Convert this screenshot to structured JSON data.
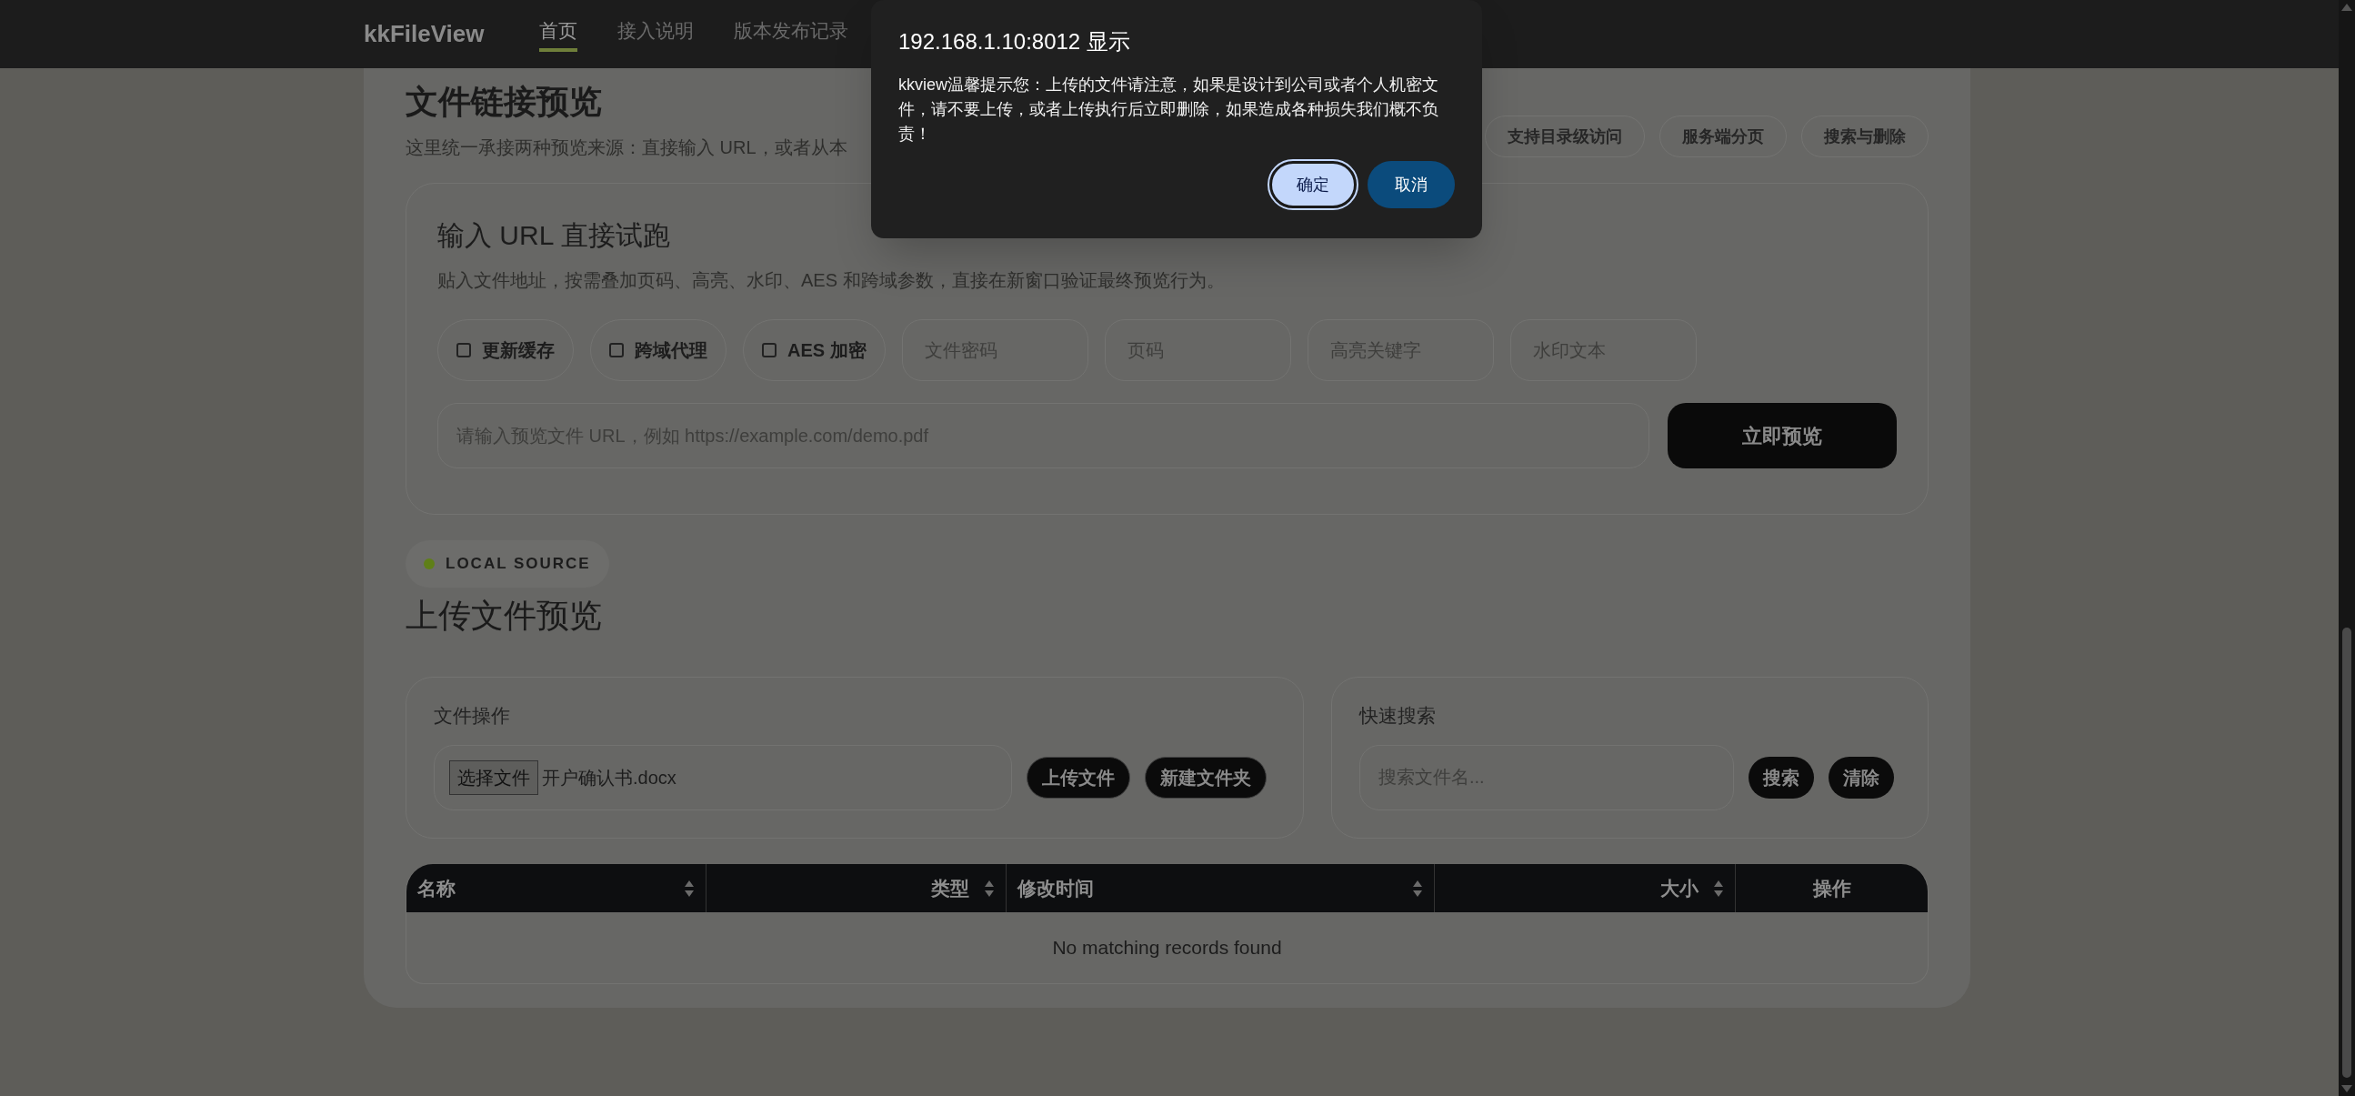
{
  "nav": {
    "brand": "kkFileView",
    "items": [
      {
        "label": "首页",
        "selected": true
      },
      {
        "label": "接入说明",
        "selected": false
      },
      {
        "label": "版本发布记录",
        "selected": false
      }
    ]
  },
  "url_section": {
    "title": "文件链接预览",
    "subtitle": "这里统一承接两种预览来源：直接输入 URL，或者从本",
    "tags": [
      "支持目录级访问",
      "服务端分页",
      "搜索与删除"
    ],
    "card": {
      "title": "输入 URL 直接试跑",
      "description": "贴入文件地址，按需叠加页码、高亮、水印、AES 和跨域参数，直接在新窗口验证最终预览行为。",
      "options": [
        {
          "label": "更新缓存",
          "checked": false
        },
        {
          "label": "跨域代理",
          "checked": false
        },
        {
          "label": "AES 加密",
          "checked": false
        }
      ],
      "fields": [
        {
          "placeholder": "文件密码"
        },
        {
          "placeholder": "页码"
        },
        {
          "placeholder": "高亮关键字"
        },
        {
          "placeholder": "水印文本"
        }
      ],
      "url_field": {
        "placeholder": "请输入预览文件 URL，例如 https://example.com/demo.pdf"
      },
      "submit": "立即预览"
    }
  },
  "local_section": {
    "badge": "LOCAL SOURCE",
    "title": "上传文件预览",
    "file_ops": {
      "title": "文件操作",
      "choose_button": "选择文件",
      "chosen_file": "开户确认书.docx",
      "buttons": [
        "上传文件",
        "新建文件夹"
      ]
    },
    "search": {
      "title": "快速搜索",
      "placeholder": "搜索文件名...",
      "buttons": [
        "搜索",
        "清除"
      ]
    },
    "table": {
      "columns": [
        {
          "label": "名称",
          "sortable": true
        },
        {
          "label": "类型",
          "sortable": true
        },
        {
          "label": "修改时间",
          "sortable": true
        },
        {
          "label": "大小",
          "sortable": true
        },
        {
          "label": "操作",
          "sortable": false
        }
      ],
      "empty": "No matching records found"
    }
  },
  "dialog": {
    "title": "192.168.1.10:8012 显示",
    "message": "kkview温馨提示您：上传的文件请注意，如果是设计到公司或者个人机密文件，请不要上传，或者上传执行后立即删除，如果造成各种损失我们概不负责！",
    "buttons": [
      {
        "label": "确定",
        "selected": true
      },
      {
        "label": "取消",
        "selected": false
      }
    ]
  }
}
